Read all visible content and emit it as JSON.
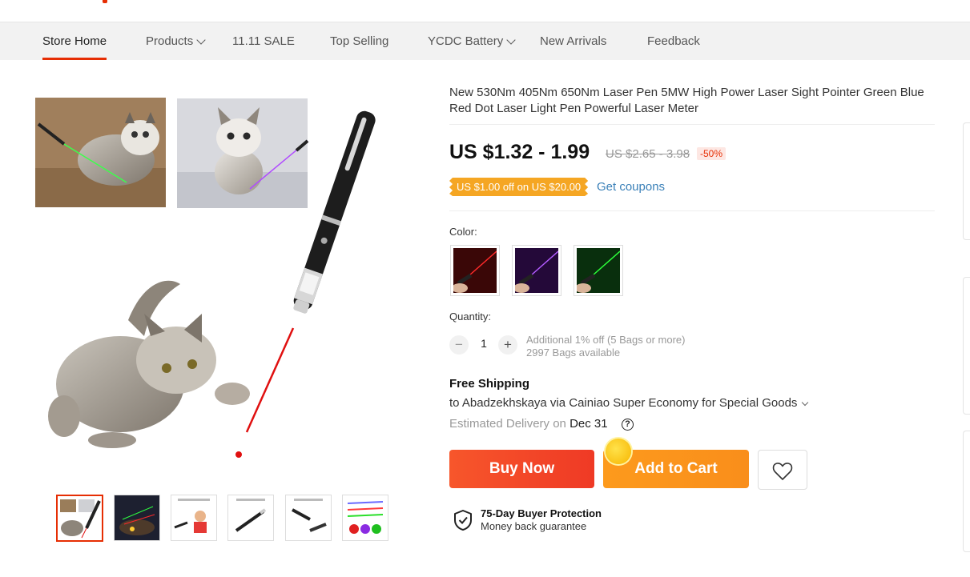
{
  "nav": {
    "items": [
      {
        "label": "Store Home"
      },
      {
        "label": "Products"
      },
      {
        "label": "11.11 SALE"
      },
      {
        "label": "Top Selling"
      },
      {
        "label": "YCDC Battery"
      },
      {
        "label": "New Arrivals"
      },
      {
        "label": "Feedback"
      }
    ]
  },
  "product": {
    "title": "New 530Nm 405Nm 650Nm Laser Pen 5MW High Power Laser Sight Pointer Green Blue Red Dot Laser Light Pen Powerful Laser Meter",
    "price": "US $1.32 - 1.99",
    "original_price": "US $2.65 - 3.98",
    "discount": "-50%",
    "coupon": "US $1.00 off on US $20.00",
    "get_coupons": "Get coupons",
    "color_label": "Color:",
    "colors": [
      {
        "name": "red",
        "hex": "#d01010"
      },
      {
        "name": "purple",
        "hex": "#8a2be2"
      },
      {
        "name": "green",
        "hex": "#19c41e"
      }
    ],
    "quantity_label": "Quantity:",
    "quantity": "1",
    "minus": "−",
    "plus": "+",
    "quantity_note": "Additional 1% off (5 Bags or more)",
    "available": "2997 Bags available",
    "shipping_title": "Free Shipping",
    "shipping_to": "to Abadzekhskaya via Cainiao Super Economy for Special Goods",
    "delivery_label": "Estimated Delivery on",
    "delivery_date": "Dec 31",
    "help_glyph": "?",
    "buy_now": "Buy Now",
    "add_to_cart": "Add to Cart",
    "protection_title": "75-Day Buyer Protection",
    "protection_sub": "Money back guarantee"
  },
  "colors": {
    "accent": "#e62e04",
    "buy": "#f44b29",
    "cart": "#fd9a1c",
    "coupon": "#f5a623",
    "link": "#3a80b8"
  }
}
